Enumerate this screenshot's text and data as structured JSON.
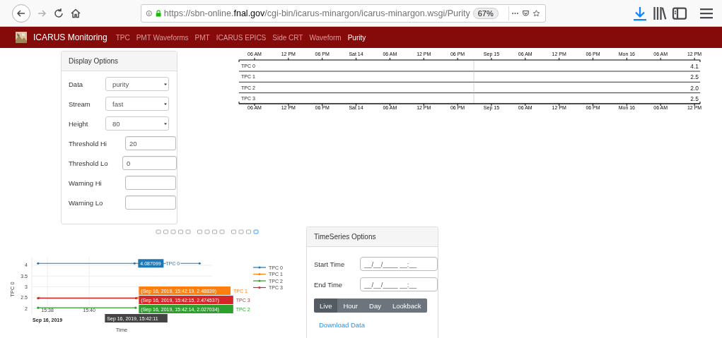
{
  "browser": {
    "url_prefix": "https://sbn-online.",
    "url_domain": "fnal.gov",
    "url_path": "/cgi-bin/icarus-minargon/icarus-minargon.wsgi/Purity",
    "zoom": "67%"
  },
  "navbar": {
    "brand": "ICARUS Monitoring",
    "links": [
      {
        "label": "TPC",
        "selected": false
      },
      {
        "label": "PMT Waveforms",
        "selected": false
      },
      {
        "label": "PMT",
        "selected": false
      },
      {
        "label": "ICARUS EPICS",
        "selected": false
      },
      {
        "label": "Side CRT",
        "selected": false
      },
      {
        "label": "Waveform",
        "selected": false
      },
      {
        "label": "Purity",
        "selected": true
      }
    ]
  },
  "display_options": {
    "title": "Display Options",
    "fields": [
      {
        "kind": "select",
        "label": "Data",
        "value": "purity"
      },
      {
        "kind": "select",
        "label": "Stream",
        "value": "fast"
      },
      {
        "kind": "select",
        "label": "Height",
        "value": "80"
      },
      {
        "kind": "input",
        "label": "Threshold Hi",
        "value": "20"
      },
      {
        "kind": "input",
        "label": "Threshold Lo",
        "value": "0"
      },
      {
        "kind": "input",
        "label": "Warning Hi"
      },
      {
        "kind": "input",
        "label": "Warning Lo"
      }
    ]
  },
  "horizon": {
    "top_ticks": [
      "06 AM",
      "12 PM",
      "06 PM",
      "Sat 14",
      "06 AM",
      "12 PM",
      "06 PM",
      "Sep 15",
      "06 AM",
      "12 PM",
      "06 PM",
      "Mon 16",
      "06 AM",
      "12 PM"
    ],
    "rows": [
      {
        "name": "TPC 0",
        "value": "4.1"
      },
      {
        "name": "TPC 1",
        "value": "2.5"
      },
      {
        "name": "TPC 2",
        "value": "2.0"
      },
      {
        "name": "TPC 3",
        "value": "2.5"
      }
    ],
    "bottom_ticks": [
      "06 AM",
      "12 PM",
      "06 PM",
      "Sat 14",
      "06 AM",
      "12 PM",
      "06 PM",
      "Sep 15",
      "06 AM",
      "12 PM",
      "06 PM",
      "Mon 16",
      "06 AM",
      "12 PM"
    ]
  },
  "plot": {
    "chart_data": {
      "type": "line",
      "xlabel": "Time",
      "ylabel": "TPC 0",
      "x": [
        937.55,
        937.6,
        942.18,
        942.23,
        942.25,
        942.32,
        945.3
      ],
      "xlim": [
        937.25,
        945.9
      ],
      "ylim": [
        1.74,
        4.36
      ],
      "grid": true,
      "legend": "right",
      "xticks": [
        {
          "value": 938,
          "label": "15:38"
        },
        {
          "value": 940,
          "label": "15:40"
        }
      ],
      "yticks": [
        2,
        2.5,
        3,
        3.5,
        4
      ],
      "series": [
        {
          "name": "TPC 0",
          "color": "#1f77b4",
          "values": [
            4.09,
            null,
            4.09,
            null,
            null,
            null,
            4.09
          ]
        },
        {
          "name": "TPC 1",
          "color": "#ff7f0e",
          "values": [
            null,
            2.49,
            null,
            null,
            null,
            2.49,
            null
          ]
        },
        {
          "name": "TPC 2",
          "color": "#2ca02c",
          "values": [
            2.03,
            null,
            null,
            2.03,
            null,
            null,
            null
          ]
        },
        {
          "name": "TPC 3",
          "color": "#d62728",
          "values": [
            2.47,
            null,
            null,
            null,
            2.47,
            null,
            null
          ]
        }
      ]
    },
    "date_label": "Sep 16, 2019",
    "hover_main": {
      "text": "4.087099",
      "name": "TPC 0",
      "color": "#1f77b4"
    },
    "hover_labels": [
      {
        "text": "(Sep 16, 2019, 15:42:19, 2.48839)",
        "name": "TPC 1",
        "color": "#ff7f0e"
      },
      {
        "text": "(Sep 16, 2019, 15:42:15, 2.474537)",
        "name": "TPC 3",
        "color": "#d62728"
      },
      {
        "text": "(Sep 16, 2019, 15:42:14, 2.027034)",
        "name": "TPC 2",
        "color": "#2ca02c"
      }
    ],
    "hover_x": "Sep 16, 2019, 15:42:11"
  },
  "timeseries": {
    "title": "TimeSeries Options",
    "fields": [
      {
        "label": "Start Time",
        "placeholder": "__/__/____ __:__"
      },
      {
        "label": "End Time",
        "placeholder": "__/__/____ __:__"
      }
    ],
    "buttons": [
      {
        "label": "Live",
        "selected": true
      },
      {
        "label": "Hour",
        "selected": false
      },
      {
        "label": "Day",
        "selected": false
      },
      {
        "label": "Lookback",
        "selected": false
      }
    ],
    "link": "Download Data"
  }
}
